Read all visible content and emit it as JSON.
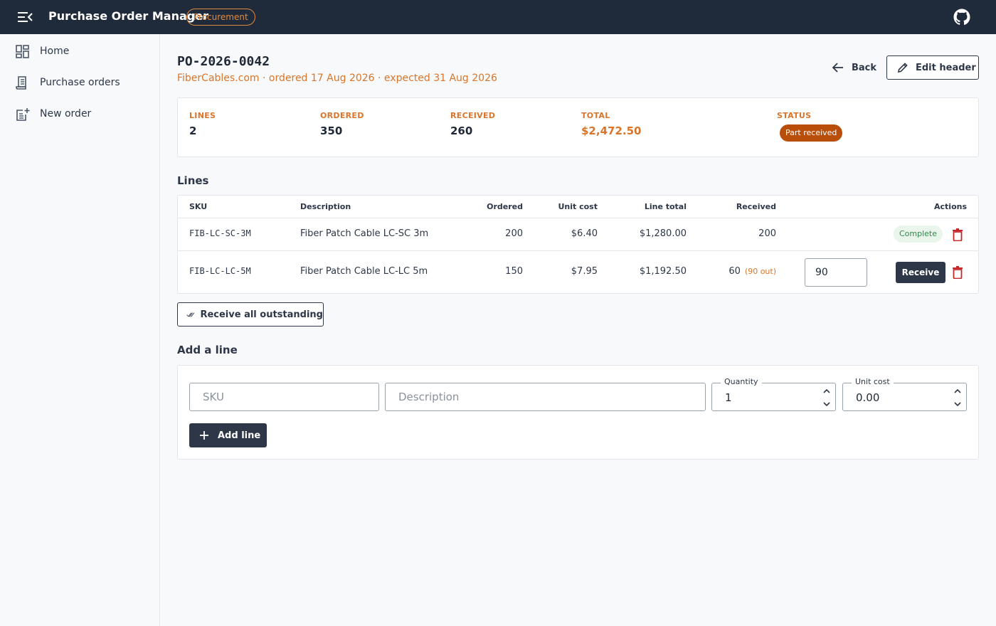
{
  "header": {
    "title": "Purchase Order Manager",
    "badge": "Procurement"
  },
  "sidebar": {
    "items": [
      {
        "label": "Home",
        "icon": "dashboard-icon"
      },
      {
        "label": "Purchase orders",
        "icon": "receipt-icon"
      },
      {
        "label": "New order",
        "icon": "add-document-icon"
      }
    ]
  },
  "order": {
    "number": "PO-2026-0042",
    "subtitle": "FiberCables.com · ordered 17 Aug 2026 · expected 31 Aug 2026",
    "back_label": "Back",
    "edit_label": "Edit header"
  },
  "summary": {
    "lines_label": "LINES",
    "lines_value": "2",
    "ordered_label": "ORDERED",
    "ordered_value": "350",
    "received_label": "RECEIVED",
    "received_value": "260",
    "total_label": "TOTAL",
    "total_value": "$2,472.50",
    "status_label": "STATUS",
    "status_value": "Part received"
  },
  "lines": {
    "title": "Lines",
    "columns": {
      "sku": "SKU",
      "description": "Description",
      "ordered": "Ordered",
      "unit_cost": "Unit cost",
      "line_total": "Line total",
      "received": "Received",
      "actions": "Actions"
    },
    "rows": [
      {
        "sku": "FIB-LC-SC-3M",
        "description": "Fiber Patch Cable LC-SC 3m",
        "ordered": "200",
        "unit_cost": "$6.40",
        "line_total": "$1,280.00",
        "received": "200",
        "outstanding": "",
        "status": "Complete",
        "receive_qty": "",
        "receive_label": ""
      },
      {
        "sku": "FIB-LC-LC-5M",
        "description": "Fiber Patch Cable LC-LC 5m",
        "ordered": "150",
        "unit_cost": "$7.95",
        "line_total": "$1,192.50",
        "received": "60",
        "outstanding": "(90 out)",
        "status": "",
        "receive_qty": "90",
        "receive_label": "Receive"
      }
    ],
    "receive_all_label": "Receive all outstanding"
  },
  "add_line": {
    "title": "Add a line",
    "sku_placeholder": "SKU",
    "description_placeholder": "Description",
    "quantity_label": "Quantity",
    "quantity_value": "1",
    "unit_cost_label": "Unit cost",
    "unit_cost_value": "0.00",
    "add_label": "Add line"
  },
  "colors": {
    "topbar": "#1f2a3a",
    "accent": "#d9752b",
    "status_part": "#b94e0a",
    "complete": "#2f8a4a",
    "danger": "#c62828",
    "primary_button": "#2d3748"
  }
}
